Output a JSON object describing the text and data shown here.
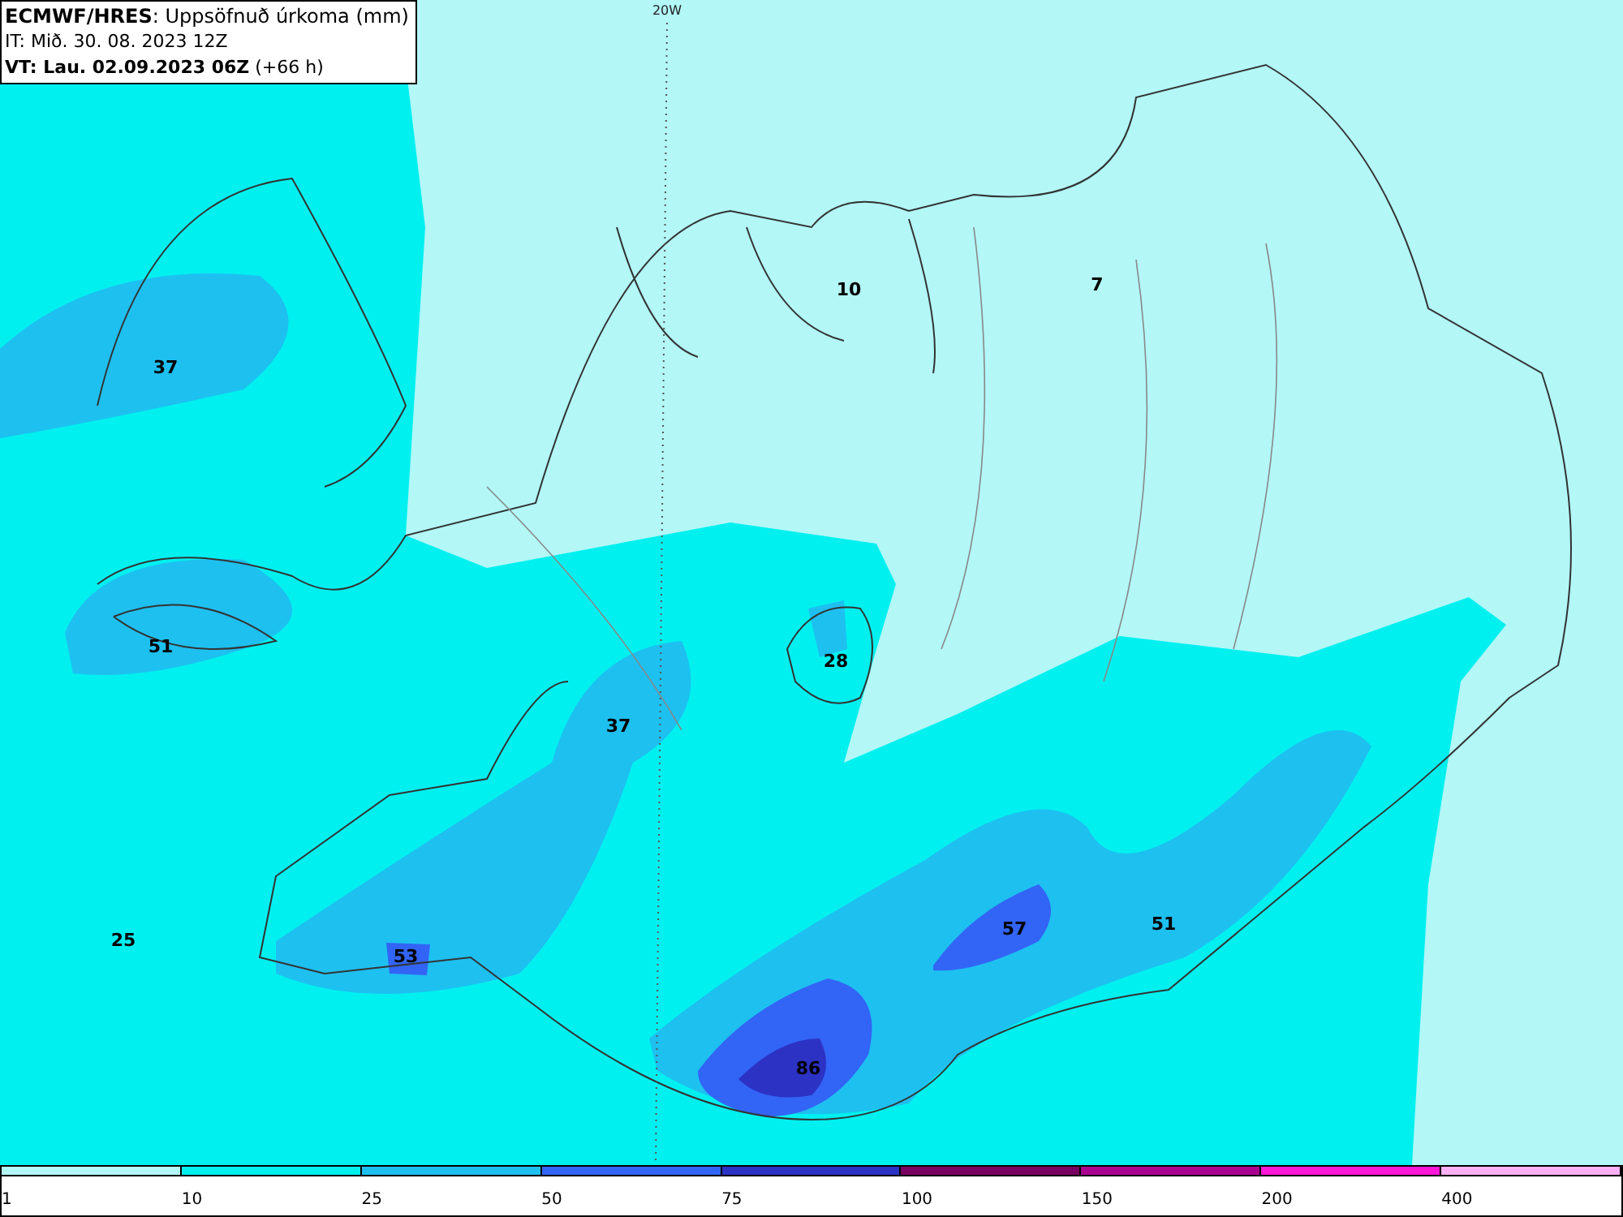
{
  "header": {
    "title": "**ECMWF/HRES**: Uppsöfnuð úrkoma (mm)",
    "issue_time": "IT: Mið. 30. 08. 2023 12Z",
    "valid_time": "**VT: Lau. 02.09.2023 06Z** (+66 h)"
  },
  "meridian_label": "20W",
  "map_values": [
    "10",
    "7",
    "37",
    "51",
    "28",
    "37",
    "25",
    "53",
    "57",
    "51",
    "86"
  ],
  "legend": [
    {
      "label": "1",
      "color": "#b3f7f7"
    },
    {
      "label": "10",
      "color": "#00f0f0"
    },
    {
      "label": "25",
      "color": "#1ec0f0"
    },
    {
      "label": "50",
      "color": "#3264f5"
    },
    {
      "label": "75",
      "color": "#2c32c4"
    },
    {
      "label": "100",
      "color": "#780060"
    },
    {
      "label": "150",
      "color": "#aa0090"
    },
    {
      "label": "200",
      "color": "#ff18d8"
    },
    {
      "label": "400",
      "color": "#ffb0f4"
    }
  ]
}
